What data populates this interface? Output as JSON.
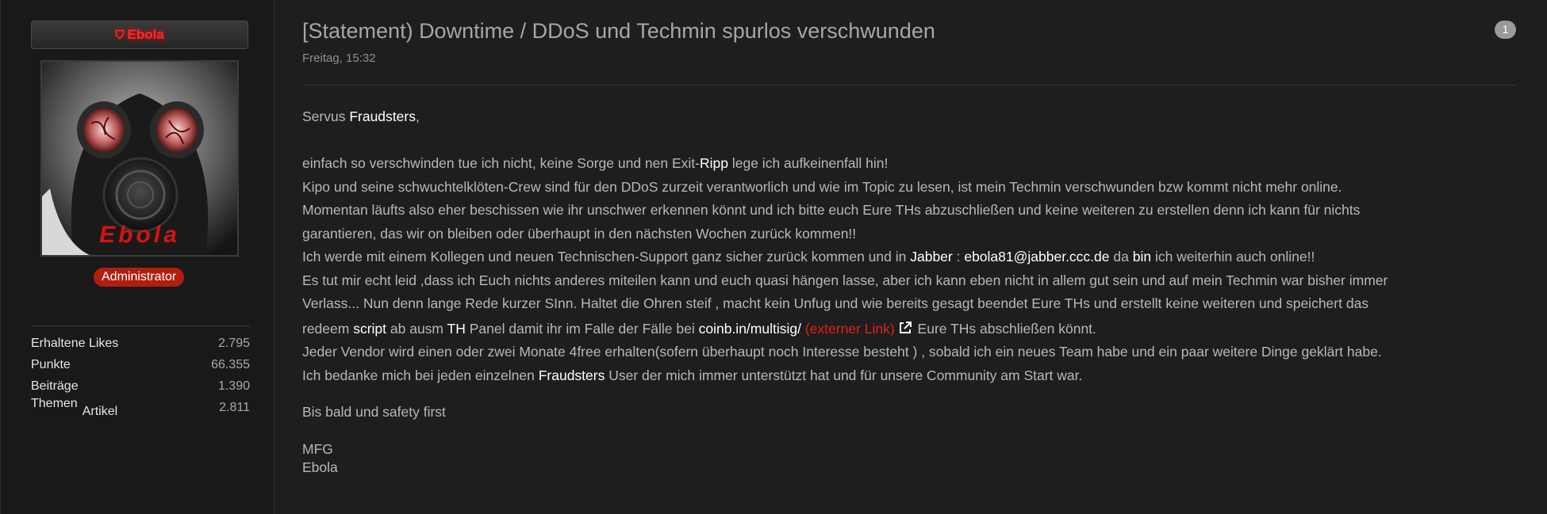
{
  "sidebar": {
    "username": "Ebola",
    "role": "Administrator",
    "avatar_text": "Ebola",
    "stats": [
      {
        "label": "Erhaltene Likes",
        "value": "2.795"
      },
      {
        "label": "Punkte",
        "value": "66.355"
      },
      {
        "label": "Beiträge",
        "value": "1.390"
      },
      {
        "label": "Themen",
        "sublabel": "Artikel",
        "value": "2.811"
      }
    ]
  },
  "post": {
    "title": "[Statement) Downtime / DDoS und Techmin spurlos verschwunden",
    "date": "Freitag, 15:32",
    "number": "1",
    "greeting_pre": "Servus ",
    "greeting_name": "Fraudsters",
    "greeting_post": ",",
    "line1_a": "einfach so verschwinden tue ich nicht, keine Sorge und nen Exit-",
    "line1_hl": "Ripp",
    "line1_b": " lege ich aufkeinenfall hin!",
    "line2": "Kipo und seine schwuchtelklöten-Crew sind für den DDoS zurzeit verantworlich und wie im Topic zu lesen, ist mein Techmin verschwunden bzw kommt nicht mehr online.",
    "line3": "Momentan läufts also eher beschissen wie ihr unschwer erkennen könnt und ich bitte euch Eure THs abzuschließen und keine weiteren zu erstellen denn ich kann für nichts",
    "line4": "garantieren, das wir on bleiben oder überhaupt in den nächsten Wochen zurück kommen!!",
    "line5_a": "Ich werde mit einem Kollegen und neuen Technischen-Support ganz sicher zurück kommen und in ",
    "line5_jabber": "Jabber",
    "line5_colon": " : ",
    "line5_email": "ebola81@jabber.ccc.de",
    "line5_da": " da ",
    "line5_bin": "bin",
    "line5_b": " ich weiterhin auch online!!",
    "line6": "Es tut mir echt leid ,dass ich Euch nichts anderes miteilen kann und euch quasi hängen lasse, aber ich kann eben nicht in allem gut sein und auf mein Techmin war bisher immer",
    "line7": "Verlass... Nun denn lange Rede kurzer SInn. Haltet die Ohren steif , macht kein Unfug und wie bereits gesagt beendet Eure THs und erstellt keine weiteren und speichert das",
    "line8_a": "redeem ",
    "line8_script": "script",
    "line8_b": " ab ausm ",
    "line8_th": "TH",
    "line8_c": " Panel damit ihr im Falle der Fälle bei ",
    "line8_link": "coinb.in/multisig/",
    "line8_ext": "(externer Link)",
    "line8_d": " Eure THs abschließen könnt.",
    "line9": "Jeder Vendor wird einen oder zwei Monate 4free erhalten(sofern überhaupt noch Interesse besteht ) , sobald ich ein neues Team habe und ein paar weitere Dinge geklärt habe.",
    "line10_a": "Ich bedanke mich bei jeden einzelnen ",
    "line10_hl": "Fraudsters",
    "line10_b": " User der mich immer unterstützt hat und für unsere Community am Start war.",
    "closing": "Bis bald und safety first",
    "sign1": "MFG",
    "sign2": "Ebola"
  },
  "colors": {
    "background": "#1e1e1e",
    "username": "#ff2a2a",
    "role_badge": "#b01e10",
    "highlight": "#ffffff",
    "external_link": "#e0201a"
  },
  "icons": {
    "username": "shield-icon",
    "external_link": "external-link-icon"
  }
}
